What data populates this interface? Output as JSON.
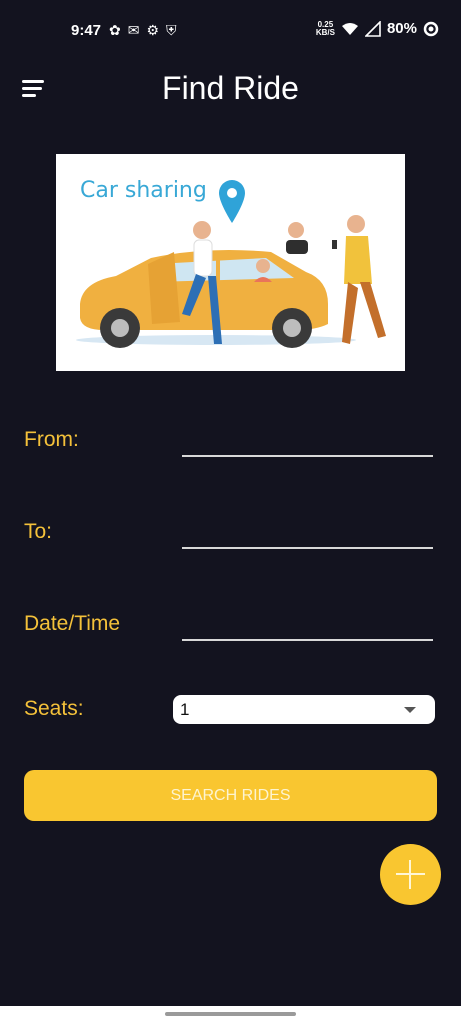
{
  "status_bar": {
    "time": "9:47",
    "net_speed_value": "0.25",
    "net_speed_unit": "KB/S",
    "battery": "80%"
  },
  "header": {
    "title": "Find Ride",
    "menu_icon": "hamburger-menu-icon"
  },
  "hero": {
    "caption": "Car sharing"
  },
  "form": {
    "from_label": "From:",
    "to_label": "To:",
    "datetime_label": "Date/Time",
    "seats_label": "Seats:",
    "seats_value": "1"
  },
  "actions": {
    "search_label": "SEARCH RIDES",
    "fab_icon": "plus-icon"
  },
  "colors": {
    "background": "#13131f",
    "accent": "#f9c630",
    "label": "#f4c13a"
  }
}
